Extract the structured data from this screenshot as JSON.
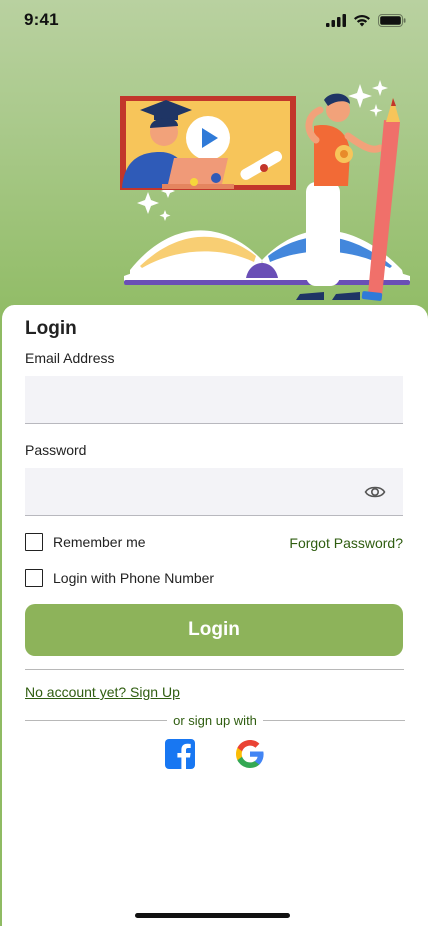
{
  "status_bar": {
    "time": "9:41"
  },
  "login": {
    "title": "Login",
    "email_label": "Email Address",
    "email_value": "",
    "password_label": "Password",
    "password_value": "",
    "remember_me": "Remember me",
    "forgot_password": "Forgot Password?",
    "login_with_phone": "Login with Phone Number",
    "login_button": "Login",
    "no_account": "No account yet? Sign Up",
    "or_sign_up_with": "or sign up with"
  },
  "social": [
    {
      "icon": "facebook-icon",
      "color": "#1877f2"
    },
    {
      "icon": "google-icon",
      "color": "#4285f4"
    }
  ],
  "theme": {
    "accent": "#8db35a",
    "link": "#2f5d10",
    "hero_top": "#b9d1a0",
    "hero_bottom": "#8fbb63"
  },
  "icons": {
    "signal": "signal-icon",
    "wifi": "wifi-icon",
    "battery": "battery-icon",
    "password_toggle": "eye-icon"
  }
}
